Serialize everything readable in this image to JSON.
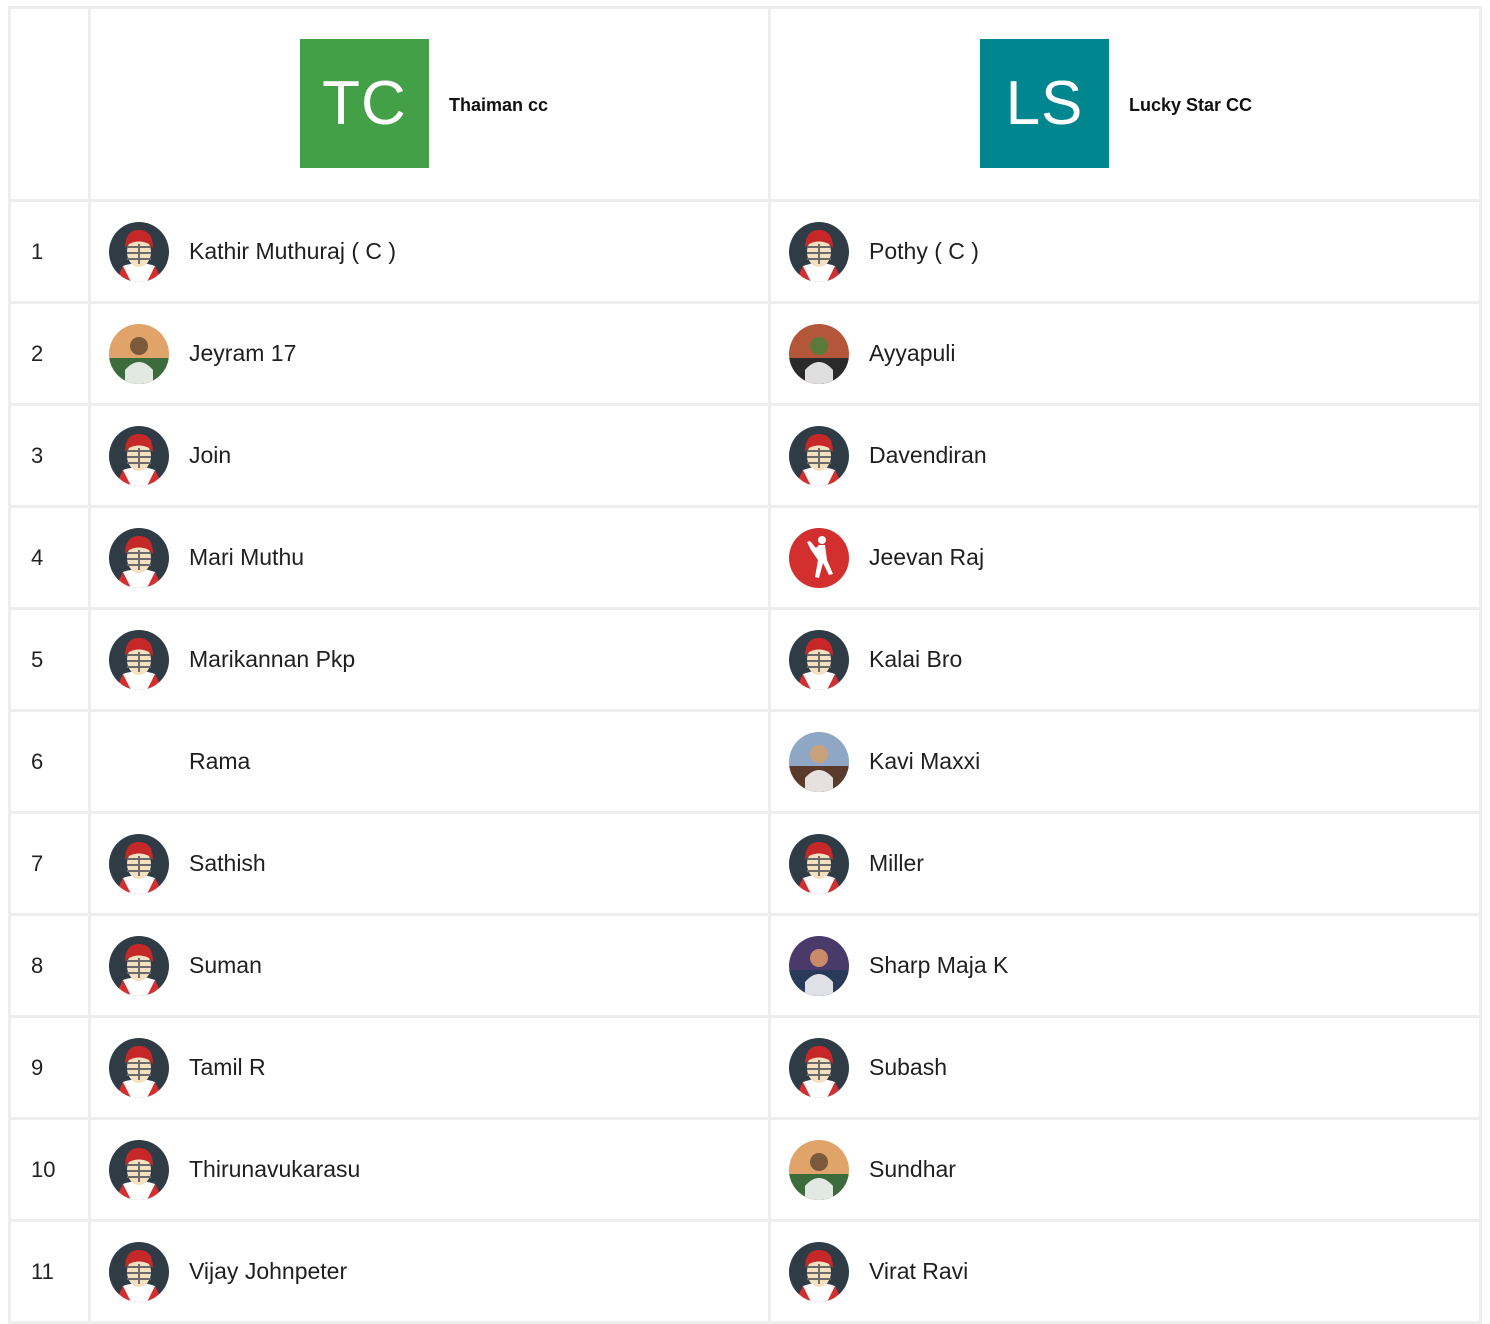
{
  "teams": [
    {
      "initials": "TC",
      "name": "Thaiman cc",
      "color": "#43a047"
    },
    {
      "initials": "LS",
      "name": "Lucky Star CC",
      "color": "#00868f"
    }
  ],
  "rows": [
    {
      "num": "1",
      "left": {
        "name": "Kathir Muthuraj ( C )",
        "avatar": "helmet-avatar-icon"
      },
      "right": {
        "name": "Pothy ( C )",
        "avatar": "helmet-avatar-icon"
      }
    },
    {
      "num": "2",
      "left": {
        "name": "Jeyram 17",
        "avatar": "player-photo"
      },
      "right": {
        "name": "Ayyapuli",
        "avatar": "player-photo"
      }
    },
    {
      "num": "3",
      "left": {
        "name": "Join",
        "avatar": "helmet-avatar-icon"
      },
      "right": {
        "name": "Davendiran",
        "avatar": "helmet-avatar-icon"
      }
    },
    {
      "num": "4",
      "left": {
        "name": "Mari Muthu",
        "avatar": "helmet-avatar-icon"
      },
      "right": {
        "name": "Jeevan Raj",
        "avatar": "bowler-icon"
      }
    },
    {
      "num": "5",
      "left": {
        "name": "Marikannan Pkp",
        "avatar": "helmet-avatar-icon"
      },
      "right": {
        "name": "Kalai Bro",
        "avatar": "helmet-avatar-icon"
      }
    },
    {
      "num": "6",
      "left": {
        "name": "Rama",
        "avatar": "none"
      },
      "right": {
        "name": "Kavi Maxxi",
        "avatar": "player-photo"
      }
    },
    {
      "num": "7",
      "left": {
        "name": "Sathish",
        "avatar": "helmet-avatar-icon"
      },
      "right": {
        "name": "Miller",
        "avatar": "helmet-avatar-icon"
      }
    },
    {
      "num": "8",
      "left": {
        "name": "Suman",
        "avatar": "helmet-avatar-icon"
      },
      "right": {
        "name": "Sharp Maja K",
        "avatar": "player-photo"
      }
    },
    {
      "num": "9",
      "left": {
        "name": "Tamil R",
        "avatar": "helmet-avatar-icon"
      },
      "right": {
        "name": "Subash",
        "avatar": "helmet-avatar-icon"
      }
    },
    {
      "num": "10",
      "left": {
        "name": "Thirunavukarasu",
        "avatar": "helmet-avatar-icon"
      },
      "right": {
        "name": "Sundhar",
        "avatar": "player-photo"
      }
    },
    {
      "num": "11",
      "left": {
        "name": "Vijay Johnpeter",
        "avatar": "helmet-avatar-icon"
      },
      "right": {
        "name": "Virat Ravi",
        "avatar": "helmet-avatar-icon"
      }
    }
  ]
}
